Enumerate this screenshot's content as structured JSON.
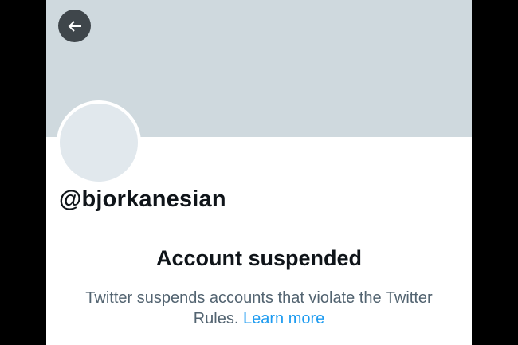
{
  "profile": {
    "handle": "@bjorkanesian"
  },
  "suspension": {
    "title": "Account suspended",
    "message": "Twitter suspends accounts that violate the Twitter Rules.",
    "link_text": "Learn more"
  },
  "icons": {
    "back": "arrow-left-icon"
  },
  "colors": {
    "banner": "#cfd9de",
    "avatar": "#e1e8ed",
    "link": "#1d9bf0",
    "secondary_text": "#536471",
    "primary_text": "#0f1419"
  }
}
